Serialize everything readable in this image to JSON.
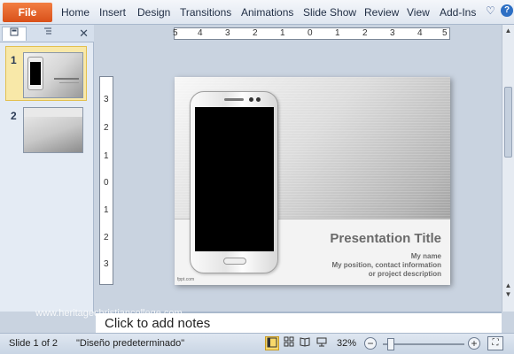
{
  "ribbon": {
    "file_label": "File",
    "tabs": [
      {
        "label": "Home"
      },
      {
        "label": "Insert"
      },
      {
        "label": "Design"
      },
      {
        "label": "Transitions"
      },
      {
        "label": "Animations"
      },
      {
        "label": "Slide Show"
      },
      {
        "label": "Review"
      },
      {
        "label": "View"
      },
      {
        "label": "Add-Ins"
      }
    ],
    "heart_icon": "heart-icon",
    "help_icon": "help-icon",
    "help_glyph": "?"
  },
  "left_pane": {
    "close_glyph": "✕",
    "slides": [
      {
        "number": "1",
        "selected": true
      },
      {
        "number": "2",
        "selected": false
      }
    ]
  },
  "ruler": {
    "horizontal": [
      "5",
      "4",
      "3",
      "2",
      "1",
      "0",
      "1",
      "2",
      "3",
      "4",
      "5"
    ],
    "vertical": [
      "3",
      "2",
      "1",
      "0",
      "1",
      "2",
      "3"
    ]
  },
  "slide": {
    "title": "Presentation Title",
    "subtitle_lines": [
      "My name",
      "My position, contact information",
      "or project description"
    ],
    "footer": "fppt.com"
  },
  "notes": {
    "placeholder": "Click to add notes"
  },
  "watermark": "www.heritagechristiancollege.com",
  "status": {
    "slide_info": "Slide 1 of 2",
    "theme": "\"Diseño predeterminado\"",
    "zoom": "32%",
    "zoom_fraction": 0.08
  },
  "colors": {
    "file_tab": "#e5612a",
    "ribbon": "#dfe6f0",
    "thumb_selected": "#f8e8a8"
  }
}
